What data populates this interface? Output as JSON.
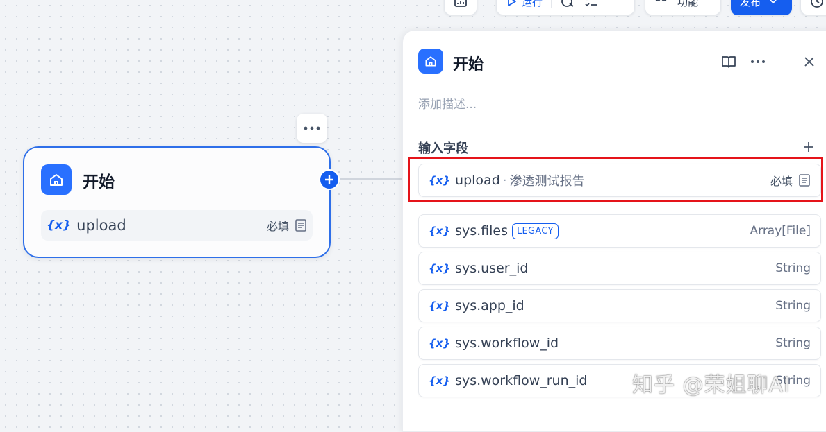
{
  "toolbar": {
    "run_label": "运行",
    "feature_label": "功能",
    "publish_label": "发布"
  },
  "node": {
    "title": "开始",
    "variable": {
      "name": "upload",
      "required_label": "必填"
    }
  },
  "panel": {
    "title": "开始",
    "description_placeholder": "添加描述...",
    "section_title": "输入字段",
    "input_field": {
      "name": "upload",
      "separator": "·",
      "label": "渗透测试报告",
      "required_label": "必填"
    },
    "system_fields": [
      {
        "name": "sys.files",
        "badge": "LEGACY",
        "type": "Array[File]"
      },
      {
        "name": "sys.user_id",
        "badge": "",
        "type": "String"
      },
      {
        "name": "sys.app_id",
        "badge": "",
        "type": "String"
      },
      {
        "name": "sys.workflow_id",
        "badge": "",
        "type": "String"
      },
      {
        "name": "sys.workflow_run_id",
        "badge": "",
        "type": "String"
      }
    ]
  },
  "watermark": "知乎 @荣姐聊AI",
  "colors": {
    "accent": "#155eef",
    "node_border": "#2e6fe9",
    "highlight": "#e5141a"
  }
}
